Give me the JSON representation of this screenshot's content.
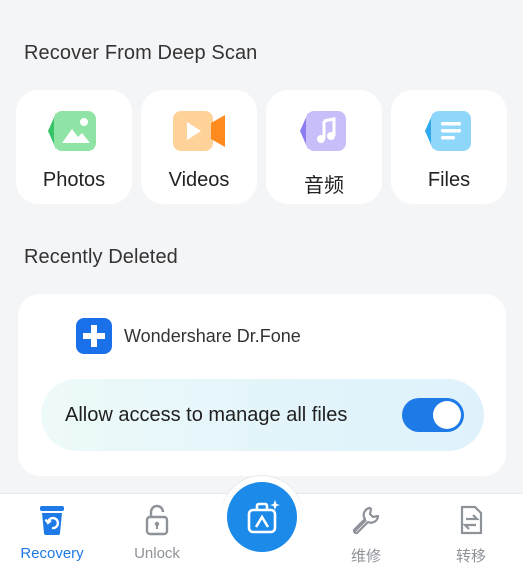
{
  "deep_scan": {
    "title": "Recover From Deep Scan",
    "categories": [
      {
        "label": "Photos",
        "icon": "photo-icon"
      },
      {
        "label": "Videos",
        "icon": "video-icon"
      },
      {
        "label": "音频",
        "icon": "music-icon"
      },
      {
        "label": "Files",
        "icon": "file-icon"
      }
    ]
  },
  "recently_deleted": {
    "title": "Recently Deleted",
    "app_name": "Wondershare Dr.Fone",
    "permission_text": "Allow access to manage all files",
    "permission_enabled": true
  },
  "bottom_nav": {
    "items": [
      {
        "label": "Recovery",
        "icon": "recovery-icon",
        "active": true
      },
      {
        "label": "Unlock",
        "icon": "lock-icon",
        "active": false
      },
      {
        "label": "维修",
        "icon": "wrench-icon",
        "active": false
      },
      {
        "label": "转移",
        "icon": "transfer-icon",
        "active": false
      }
    ],
    "center_icon": "toolbox-icon"
  },
  "colors": {
    "accent": "#1d7ae6",
    "inactive": "#8e9299",
    "background": "#f4f5f7"
  }
}
